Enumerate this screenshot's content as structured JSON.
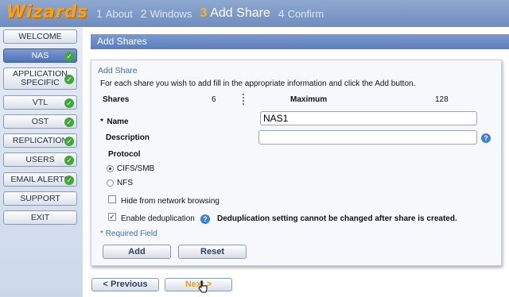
{
  "brand": "Wizards",
  "steps": [
    {
      "num": "1",
      "label": "About"
    },
    {
      "num": "2",
      "label": "Windows"
    },
    {
      "num": "3",
      "label": "Add Share"
    },
    {
      "num": "4",
      "label": "Confirm"
    }
  ],
  "sidebar": {
    "items": [
      {
        "label": "WELCOME"
      },
      {
        "label": "NAS"
      },
      {
        "label1": "APPLICATION",
        "label2": "SPECIFIC"
      },
      {
        "label": "VTL"
      },
      {
        "label": "OST"
      },
      {
        "label": "REPLICATION"
      },
      {
        "label": "USERS"
      },
      {
        "label": "EMAIL ALERTS"
      },
      {
        "label": "SUPPORT"
      },
      {
        "label": "EXIT"
      }
    ]
  },
  "header": {
    "title": "Add Shares"
  },
  "form": {
    "title": "Add Share",
    "instructions": "For each share you wish to add fill in the appropriate information and click the Add button.",
    "shares_label": "Shares",
    "shares_value": "6",
    "maximum_label": "Maximum",
    "maximum_value": "128",
    "name_asterisk": "*",
    "name_label": "Name",
    "name_value": "NAS1",
    "description_label": "Description",
    "description_value": "",
    "protocol_label": "Protocol",
    "protocol_options": [
      "CIFS/SMB",
      "NFS"
    ],
    "protocol_selected": "CIFS/SMB",
    "hide_label": "Hide from network browsing",
    "hide_checked": false,
    "dedup_label": "Enable deduplication",
    "dedup_checked": true,
    "dedup_note": "Deduplication setting cannot be changed after share is created.",
    "required_note": "* Required Field",
    "add_label": "Add",
    "reset_label": "Reset"
  },
  "nav": {
    "previous_label": "< Previous",
    "next_label": "Next >"
  },
  "colors": {
    "accent": "#f7a11a",
    "header": "#5a7dbd",
    "check": "#3fa838"
  }
}
